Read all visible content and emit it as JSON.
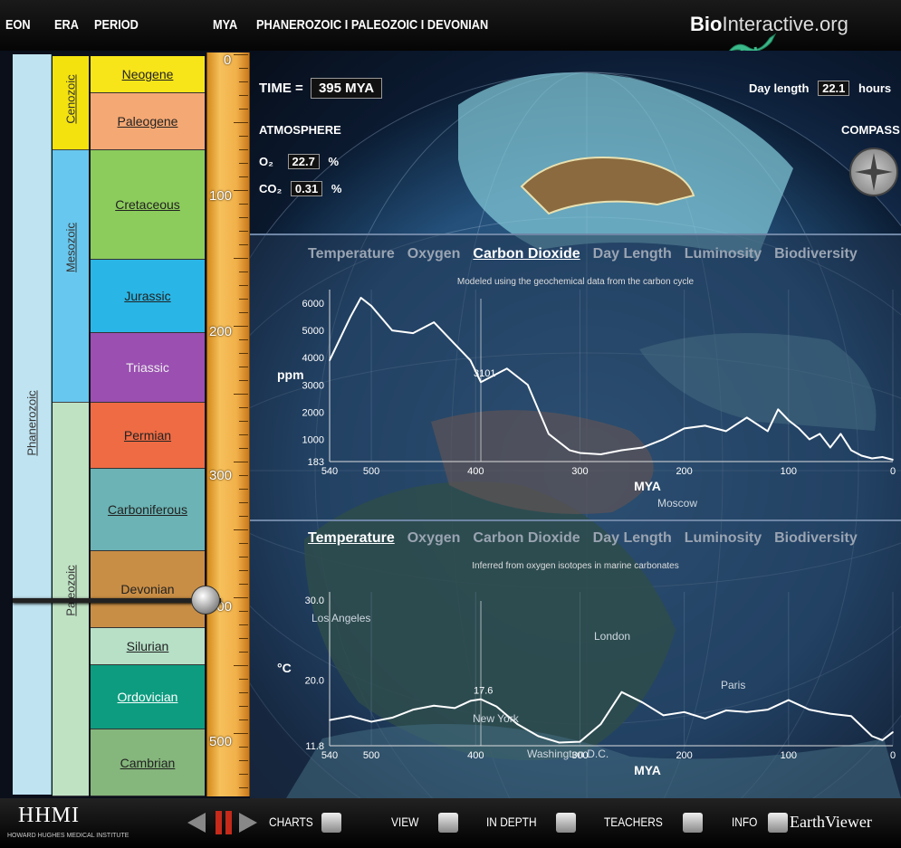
{
  "header": {
    "col_eon": "EON",
    "col_era": "ERA",
    "col_period": "PERIOD",
    "col_mya": "MYA",
    "breadcrumb": "PHANEROZOIC I PALEOZOIC I DEVONIAN",
    "logo_bold": "Bio",
    "logo_rest": "Interactive.org"
  },
  "eon": {
    "label": "Phanerozoic",
    "color": "#bfe3f1"
  },
  "eras": [
    {
      "label": "Cenozoic",
      "color": "#f3e20e"
    },
    {
      "label": "Mesozoic",
      "color": "#68c7ee"
    },
    {
      "label": "Paleozoic",
      "color": "#bfe2c3"
    }
  ],
  "periods": [
    {
      "label": "Neogene",
      "color": "#f7e51a"
    },
    {
      "label": "Paleogene",
      "color": "#f4a873"
    },
    {
      "label": "Cretaceous",
      "color": "#8ccc5c"
    },
    {
      "label": "Jurassic",
      "color": "#29b6e6"
    },
    {
      "label": "Triassic",
      "color": "#9a4fb1"
    },
    {
      "label": "Permian",
      "color": "#ee6b44"
    },
    {
      "label": "Carboniferous",
      "color": "#6bb3b4"
    },
    {
      "label": "Devonian",
      "color": "#c98e45"
    },
    {
      "label": "Silurian",
      "color": "#b7e0c7"
    },
    {
      "label": "Ordovician",
      "color": "#0d9c80"
    },
    {
      "label": "Cambrian",
      "color": "#85b67c"
    }
  ],
  "ruler": {
    "labels": [
      "0",
      "100",
      "200",
      "300",
      "400",
      "500"
    ]
  },
  "status": {
    "time_label": "TIME =",
    "time_value": "395 MYA",
    "day_label": "Day length",
    "day_value": "22.1",
    "day_unit": "hours",
    "atmosphere": "ATMOSPHERE",
    "o2_label": "O₂",
    "o2_value": "22.7",
    "o2_unit": "%",
    "co2_label": "CO₂",
    "co2_value": "0.31",
    "co2_unit": "%",
    "compass": "COMPASS"
  },
  "tabs": [
    "Temperature",
    "Oxygen",
    "Carbon Dioxide",
    "Day Length",
    "Luminosity",
    "Biodiversity"
  ],
  "chart1": {
    "active_tab": 2,
    "note": "Modeled using the geochemical data from the carbon cycle"
  },
  "chart2": {
    "active_tab": 0,
    "note": "Inferred from oxygen isotopes in marine carbonates"
  },
  "map_labels": [
    "Los Angeles",
    "London",
    "Paris",
    "New York",
    "Washington D.C.",
    "Moscow"
  ],
  "chart_data": [
    {
      "type": "line",
      "title": "Carbon Dioxide",
      "ylabel": "ppm",
      "xlabel": "MYA",
      "x_ticks": [
        "540",
        "500",
        "400",
        "300",
        "200",
        "100",
        "0"
      ],
      "y_ticks": [
        "6000",
        "5000",
        "4000",
        "3000",
        "2000",
        "1000",
        "183"
      ],
      "xlim": [
        540,
        0
      ],
      "ylim": [
        183,
        6500
      ],
      "marker": {
        "x": 395,
        "label": "3101"
      },
      "x": [
        540,
        520,
        510,
        500,
        480,
        460,
        440,
        420,
        405,
        395,
        385,
        370,
        350,
        330,
        310,
        300,
        280,
        260,
        240,
        220,
        200,
        180,
        160,
        140,
        120,
        110,
        100,
        90,
        80,
        70,
        60,
        50,
        40,
        30,
        20,
        10,
        0
      ],
      "values": [
        3900,
        5500,
        6200,
        5900,
        5000,
        4900,
        5300,
        4500,
        3900,
        3101,
        3300,
        3600,
        3000,
        1200,
        600,
        500,
        450,
        600,
        700,
        1000,
        1400,
        1500,
        1300,
        1800,
        1300,
        2100,
        1700,
        1400,
        1000,
        1200,
        700,
        1200,
        600,
        400,
        300,
        350,
        250
      ]
    },
    {
      "type": "line",
      "title": "Temperature",
      "ylabel": "°C",
      "xlabel": "MYA",
      "x_ticks": [
        "540",
        "500",
        "400",
        "300",
        "200",
        "100",
        "0"
      ],
      "y_ticks": [
        "30.0",
        "20.0",
        "11.8"
      ],
      "xlim": [
        540,
        0
      ],
      "ylim": [
        11.8,
        31
      ],
      "marker": {
        "x": 395,
        "label": "17.6"
      },
      "x": [
        540,
        520,
        500,
        480,
        460,
        440,
        420,
        405,
        395,
        380,
        360,
        340,
        320,
        300,
        280,
        260,
        240,
        220,
        200,
        180,
        160,
        140,
        120,
        100,
        80,
        60,
        40,
        20,
        10,
        0
      ],
      "values": [
        15.0,
        15.5,
        14.8,
        15.3,
        16.3,
        16.8,
        16.5,
        17.4,
        17.6,
        16.7,
        14.5,
        13.0,
        12.2,
        12.3,
        14.5,
        18.5,
        17.2,
        15.6,
        16.0,
        15.2,
        16.2,
        16.0,
        16.3,
        17.5,
        16.3,
        15.8,
        15.5,
        13.0,
        12.5,
        13.5
      ]
    }
  ],
  "footer": {
    "hhmi": "HHMI",
    "hhmi_sub": "HOWARD HUGHES MEDICAL INSTITUTE",
    "charts": "CHARTS",
    "view": "VIEW",
    "in_depth": "IN DEPTH",
    "teachers": "TEACHERS",
    "info": "INFO",
    "app_name": "EarthViewer"
  }
}
